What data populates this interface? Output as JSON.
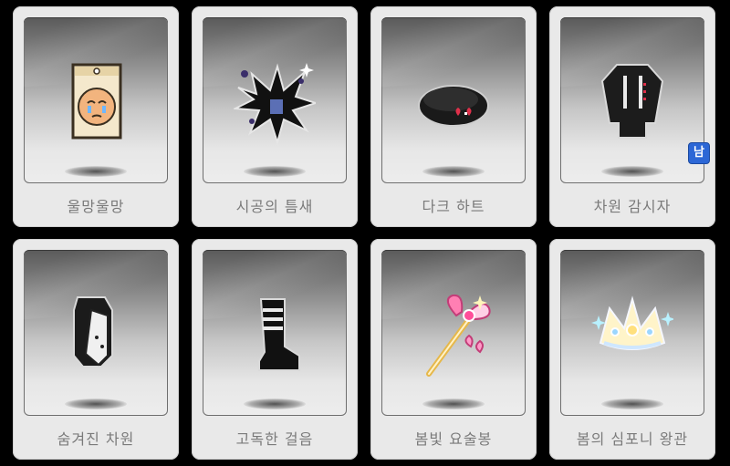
{
  "items": [
    {
      "label": "울망울망",
      "icon": "crying-face-tag-icon"
    },
    {
      "label": "시공의 틈새",
      "icon": "dimension-rift-icon"
    },
    {
      "label": "다크 하트",
      "icon": "dark-beret-icon"
    },
    {
      "label": "차원 감시자",
      "icon": "dark-coat-icon",
      "badge": "남"
    },
    {
      "label": "숨겨진 차원",
      "icon": "dark-cape-icon"
    },
    {
      "label": "고독한 걸음",
      "icon": "dark-boots-icon"
    },
    {
      "label": "봄빛 요술봉",
      "icon": "spring-magic-wand-icon"
    },
    {
      "label": "봄의 심포니 왕관",
      "icon": "spring-crown-icon"
    }
  ],
  "colors": {
    "badge": "#2c67d6",
    "label": "#7a7a7a",
    "card": "#e9e9e9"
  }
}
